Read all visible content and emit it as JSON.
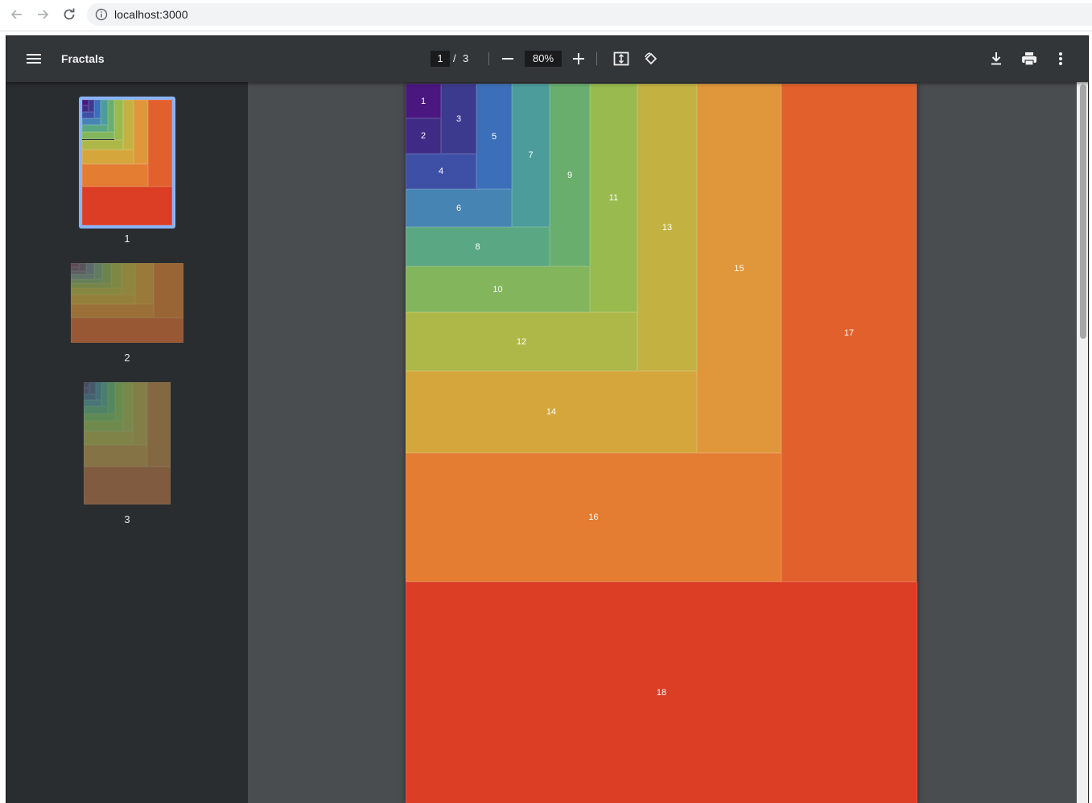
{
  "browser": {
    "url": "localhost:3000",
    "back_icon": "arrow-left-icon",
    "forward_icon": "arrow-right-icon",
    "reload_icon": "reload-icon",
    "info_icon": "info-icon"
  },
  "toolbar": {
    "menu_icon": "hamburger-icon",
    "title": "Fractals",
    "current_page": "1",
    "page_separator": "/",
    "total_pages": "3",
    "zoom": "80%",
    "icons": [
      "minus-icon",
      "plus-icon",
      "fit-page-icon",
      "rotate-icon",
      "download-icon",
      "print-icon",
      "more-vert-icon"
    ]
  },
  "sidebar": {
    "thumbnails": [
      {
        "label": "1",
        "selected": true,
        "palette": "rainbow"
      },
      {
        "label": "2",
        "selected": false,
        "palette": "muted-olive"
      },
      {
        "label": "3",
        "selected": false,
        "palette": "muted-green"
      }
    ],
    "selected_border_color": "#8ab4f8"
  },
  "page": {
    "labels": [
      "1",
      "2",
      "3",
      "4",
      "5",
      "6",
      "7",
      "8",
      "9",
      "10",
      "11",
      "12",
      "13",
      "14",
      "15",
      "16",
      "17",
      "18"
    ],
    "colors": [
      "#4a1680",
      "#3f2a86",
      "#3b3a8e",
      "#3e4fa6",
      "#3c6fb9",
      "#4684b3",
      "#4d9c9c",
      "#5aa783",
      "#6aae6d",
      "#82b55c",
      "#98ba4e",
      "#aeb848",
      "#c3b242",
      "#d4a63b",
      "#e0963a",
      "#e47c32",
      "#e2602c",
      "#db3d25"
    ]
  }
}
